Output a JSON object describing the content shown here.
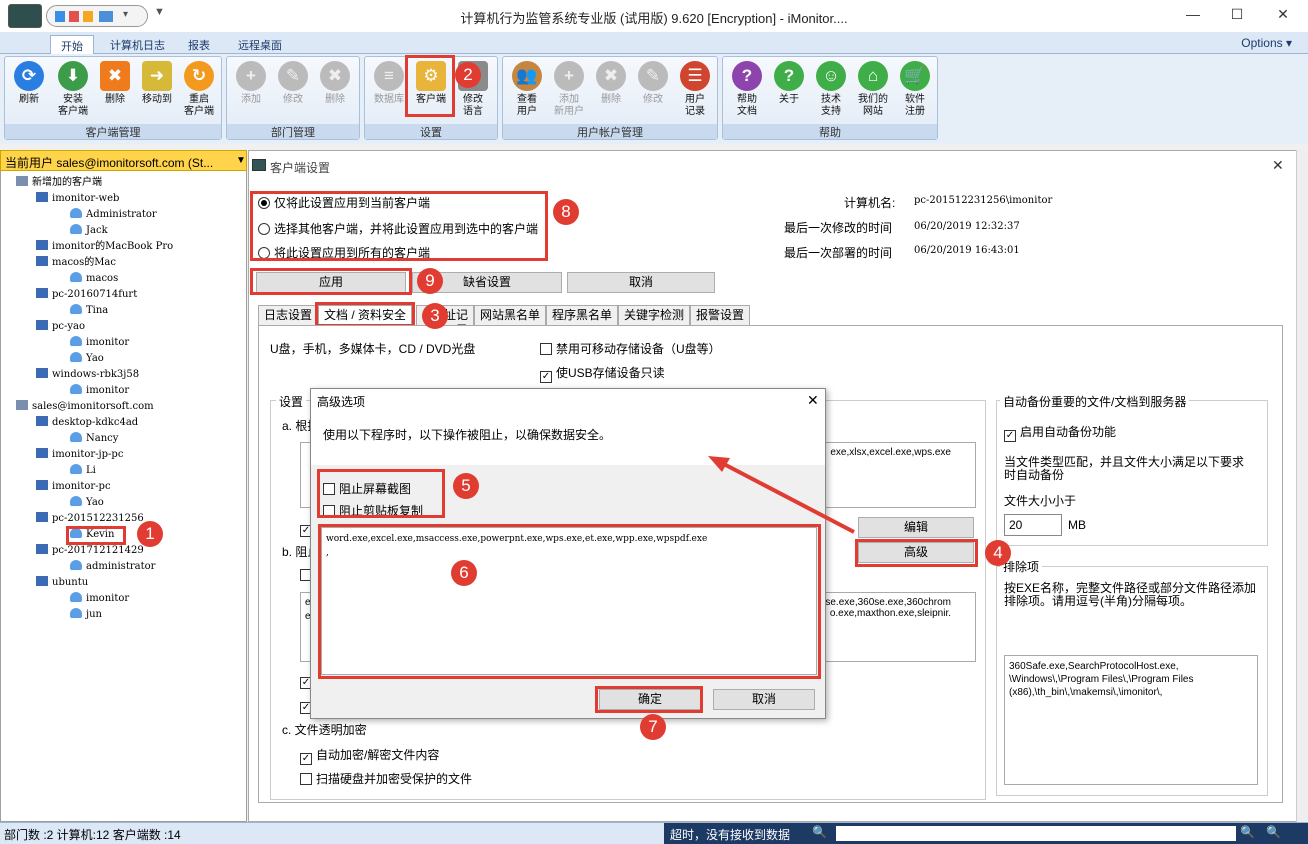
{
  "window": {
    "title": "计算机行为监管系统专业版 (试用版) 9.620 [Encryption] - iMonitor....",
    "minimize": "—",
    "maximize": "☐",
    "close": "✕"
  },
  "tabs": [
    "开始",
    "计算机日志",
    "报表",
    "远程桌面"
  ],
  "options_label": "Options ▾",
  "ribbon": {
    "groups": [
      {
        "label": "客户端管理",
        "buttons": [
          "刷新",
          "安装\n客户端",
          "删除",
          "移动到",
          "重启\n客户端"
        ]
      },
      {
        "label": "部门管理",
        "buttons": [
          "添加",
          "修改",
          "删除"
        ]
      },
      {
        "label": "设置",
        "buttons": [
          "数据库",
          "客户端",
          "修改\n语言"
        ]
      },
      {
        "label": "用户帐户管理",
        "buttons": [
          "查看\n用户",
          "添加\n新用户",
          "删除",
          "修改",
          "用户\n记录"
        ]
      },
      {
        "label": "帮助",
        "buttons": [
          "帮助\n文档",
          "关于",
          "技术\n支持",
          "我们的\n网站",
          "软件\n注册"
        ]
      }
    ]
  },
  "current_user": "当前用户 sales@imonitorsoft.com (St...",
  "tree": [
    {
      "text": "新增加的客户端",
      "level": 0,
      "type": "group"
    },
    {
      "text": "imonitor-web",
      "level": 1,
      "type": "pc"
    },
    {
      "text": "Administrator",
      "level": 2,
      "type": "user"
    },
    {
      "text": "Jack",
      "level": 2,
      "type": "user"
    },
    {
      "text": "imonitor的MacBook Pro",
      "level": 1,
      "type": "pc"
    },
    {
      "text": "macos的Mac",
      "level": 1,
      "type": "pc"
    },
    {
      "text": "macos",
      "level": 2,
      "type": "user"
    },
    {
      "text": "pc-20160714furt",
      "level": 1,
      "type": "pc"
    },
    {
      "text": "Tina",
      "level": 2,
      "type": "user"
    },
    {
      "text": "pc-yao",
      "level": 1,
      "type": "pc"
    },
    {
      "text": "imonitor",
      "level": 2,
      "type": "user"
    },
    {
      "text": "Yao",
      "level": 2,
      "type": "user"
    },
    {
      "text": "windows-rbk3j58",
      "level": 1,
      "type": "pc"
    },
    {
      "text": "imonitor",
      "level": 2,
      "type": "user"
    },
    {
      "text": "sales@imonitorsoft.com",
      "level": 0,
      "type": "group"
    },
    {
      "text": "desktop-kdkc4ad",
      "level": 1,
      "type": "pc"
    },
    {
      "text": "Nancy",
      "level": 2,
      "type": "user"
    },
    {
      "text": "imonitor-jp-pc",
      "level": 1,
      "type": "pc"
    },
    {
      "text": "Li",
      "level": 2,
      "type": "user"
    },
    {
      "text": "imonitor-pc",
      "level": 1,
      "type": "pc"
    },
    {
      "text": "Yao",
      "level": 2,
      "type": "user"
    },
    {
      "text": "pc-201512231256",
      "level": 1,
      "type": "pc"
    },
    {
      "text": "Kevin",
      "level": 2,
      "type": "user"
    },
    {
      "text": "pc-201712121429",
      "level": 1,
      "type": "pc"
    },
    {
      "text": "administrator",
      "level": 2,
      "type": "user"
    },
    {
      "text": "ubuntu",
      "level": 1,
      "type": "pc"
    },
    {
      "text": "imonitor",
      "level": 2,
      "type": "user"
    },
    {
      "text": "jun",
      "level": 2,
      "type": "user"
    }
  ],
  "dialog": {
    "title": "客户端设置",
    "scope_options": [
      "仅将此设置应用到当前客户端",
      "选择其他客户端，并将此设置应用到选中的客户端",
      "将此设置应用到所有的客户端"
    ],
    "info": [
      {
        "label": "计算机名:",
        "value": "pc-201512231256\\imonitor"
      },
      {
        "label": "最后一次修改的时间",
        "value": "06/20/2019 12:32:37"
      },
      {
        "label": "最后一次部署的时间",
        "value": "06/20/2019 16:43:01"
      }
    ],
    "apply": "应用",
    "default": "缺省设置",
    "cancel": "取消",
    "subtabs": [
      "日志设置",
      "文档 / 资料安全",
      "网址记录",
      "网站黑名单",
      "程序黑名单",
      "关键字检测",
      "报警设置"
    ],
    "usb_label": "U盘，手机，多媒体卡，CD / DVD光盘",
    "usb_disable": "禁用可移动存储设备（U盘等）",
    "usb_readonly": "使USB存储设备只读",
    "settings_legend": "设置",
    "section_a": "a. 根据",
    "section_b": "b. 阻止",
    "section_c": "c. 文件透明加密",
    "text_a": "exe,xlsx,excel.exe,wps.exe",
    "text_b": "se.exe,360se.exe,360chrom\no.exe,maxthon.exe,sleipnir.",
    "text_b_left1": "e",
    "text_b_left2": "e",
    "edit_btn": "编辑",
    "advanced_btn": "高级",
    "auto_encrypt": "自动加密/解密文件内容",
    "scan_encrypt": "扫描硬盘并加密受保护的文件",
    "backup_legend": "自动备份重要的文件/文档到服务器",
    "backup_enable": "启用自动备份功能",
    "backup_desc": "当文件类型匹配，并且文件大小满足以下要求时自动备份",
    "size_label": "文件大小小于",
    "size_value": "20",
    "size_unit": "MB",
    "exclude_legend": "排除项",
    "exclude_desc": "按EXE名称，完整文件路径或部分文件路径添加排除项。请用逗号(半角)分隔每项。",
    "exclude_text": "360Safe.exe,SearchProtocolHost.exe,\n\\Windows\\,\\Program Files\\,\\Program Files\n(x86),\\th_bin\\,\\makemsi\\,\\imonitor\\,"
  },
  "popup": {
    "title": "高级选项",
    "desc": "使用以下程序时，以下操作被阻止，以确保数据安全。",
    "block_screenshot": "阻止屏幕截图",
    "block_clipboard": "阻止剪贴板复制",
    "programs": "word.exe,excel.exe,msaccess.exe,powerpnt.exe,wps.exe,et.exe,wpp.exe,wpspdf.exe\n,",
    "ok": "确定",
    "cancel": "取消"
  },
  "markers": [
    "1",
    "2",
    "3",
    "4",
    "5",
    "6",
    "7",
    "8",
    "9"
  ],
  "status": {
    "left": "部门数 :2 计算机:12 客户端数 :14",
    "right": "超时，没有接收到数据"
  },
  "colors": {
    "accent": "#e03c31",
    "ribbon": "#dce8f6",
    "highlight": "#ffd44a"
  }
}
